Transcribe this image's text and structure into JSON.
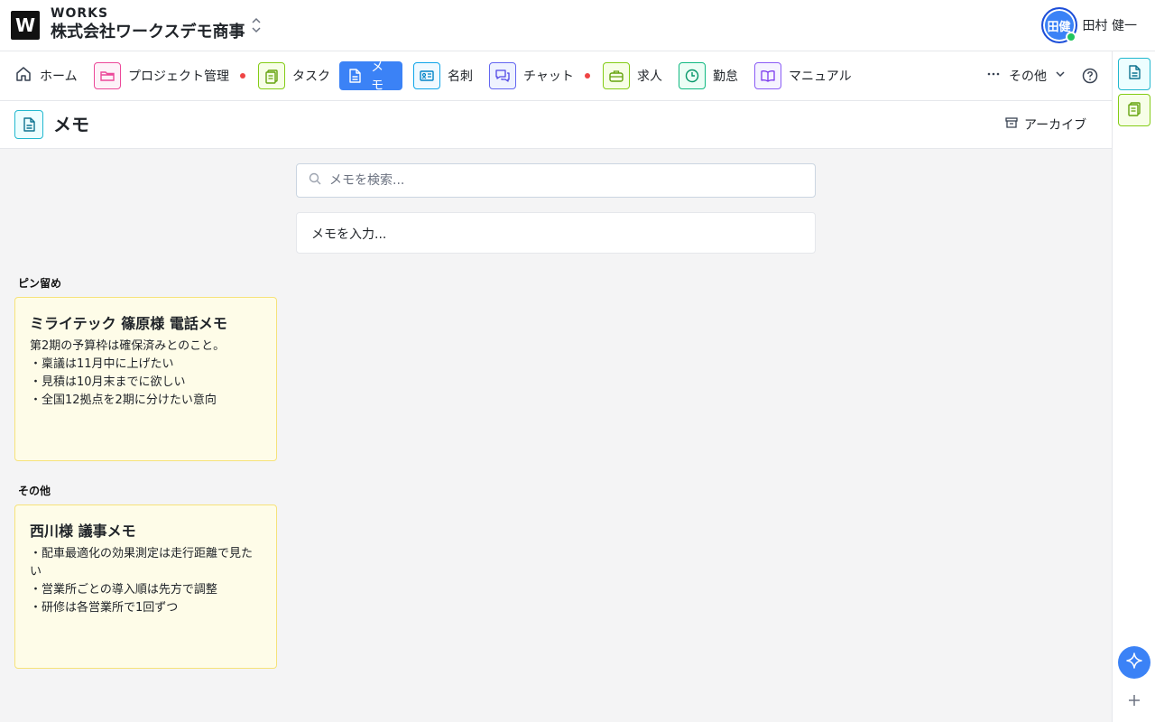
{
  "header": {
    "logo_letter": "W",
    "brand_small": "WORKS",
    "company_name": "株式会社ワークスデモ商事",
    "user": {
      "avatar_text": "田健",
      "name": "田村 健一"
    }
  },
  "nav": {
    "items": [
      {
        "label": "ホーム",
        "icon": "home-icon"
      },
      {
        "label": "プロジェクト管理",
        "icon": "folder-icon",
        "color": "#ec4899",
        "bg": "#fdf2f8",
        "badge": true
      },
      {
        "label": "タスク",
        "icon": "clipboard-icon",
        "color": "#84cc16",
        "bg": "#f7fee7"
      },
      {
        "label": "メモ",
        "icon": "memo-icon",
        "active": true
      },
      {
        "label": "名刺",
        "icon": "id-card-icon",
        "color": "#0ea5e9",
        "bg": "#f0f9ff"
      },
      {
        "label": "チャット",
        "icon": "chat-icon",
        "color": "#6366f1",
        "bg": "#eef2ff",
        "badge": true
      },
      {
        "label": "求人",
        "icon": "briefcase-icon",
        "color": "#84cc16",
        "bg": "#f7fee7"
      },
      {
        "label": "勤怠",
        "icon": "clock-icon",
        "color": "#10b981",
        "bg": "#ecfdf5"
      },
      {
        "label": "マニュアル",
        "icon": "book-icon",
        "color": "#8b5cf6",
        "bg": "#f5f3ff"
      }
    ],
    "more_label": "その他"
  },
  "page": {
    "title": "メモ",
    "archive_label": "アーカイブ"
  },
  "search": {
    "placeholder": "メモを検索..."
  },
  "new_memo": {
    "placeholder": "メモを入力..."
  },
  "sections": {
    "pinned": {
      "label": "ピン留め",
      "memos": [
        {
          "title": "ミライテック 篠原様 電話メモ",
          "body": "第2期の予算枠は確保済みとのこと。\n・稟議は11月中に上げたい\n・見積は10月末までに欲しい\n・全国12拠点を2期に分けたい意向"
        }
      ]
    },
    "other": {
      "label": "その他",
      "memos": [
        {
          "title": "西川様 議事メモ",
          "body": "・配車最適化の効果測定は走行距離で見たい\n・営業所ごとの導入順は先方で調整\n・研修は各営業所で1回ずつ"
        }
      ]
    }
  },
  "colors": {
    "accent": "#3b82f6",
    "memo_bg": "#fefce8",
    "memo_border": "#f6e27a",
    "badge": "#ef4444"
  }
}
